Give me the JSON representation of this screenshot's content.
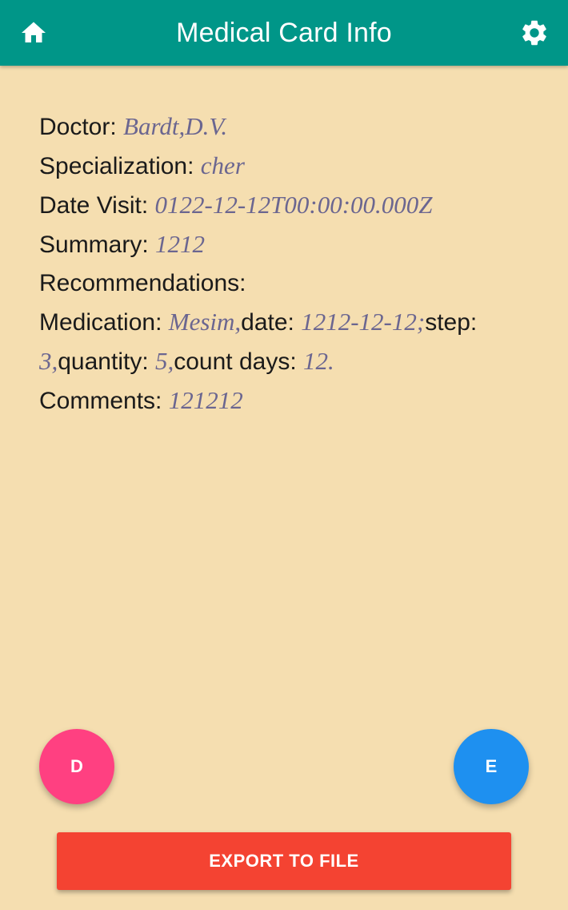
{
  "header": {
    "title": "Medical Card Info",
    "home_icon": "home-icon",
    "settings_icon": "gear-icon",
    "background_color": "#009688"
  },
  "card": {
    "doctor_label": "Doctor: ",
    "doctor_value": "Bardt,D.V.",
    "specialization_label": "Specialization: ",
    "specialization_value": "cher",
    "date_visit_label": "Date Visit: ",
    "date_visit_value": "0122-12-12T00:00:00.000Z",
    "summary_label": "Summary: ",
    "summary_value": "1212",
    "recommendations_label": "Recommendations:",
    "medication_label": "Medication: ",
    "medication_value": "Mesim,",
    "med_date_label": "date: ",
    "med_date_value": "1212-12-12;",
    "step_label": "step: ",
    "step_value": "3,",
    "quantity_label": "quantity: ",
    "quantity_value": "5,",
    "count_days_label": "count days: ",
    "count_days_value": "12.",
    "comments_label": "Comments: ",
    "comments_value": "121212"
  },
  "actions": {
    "delete_label": "D",
    "edit_label": "E",
    "export_label": "EXPORT TO FILE",
    "delete_color": "#ff4081",
    "edit_color": "#1e90f0",
    "export_color": "#f44332"
  },
  "page": {
    "background_color": "#f5deb0"
  }
}
